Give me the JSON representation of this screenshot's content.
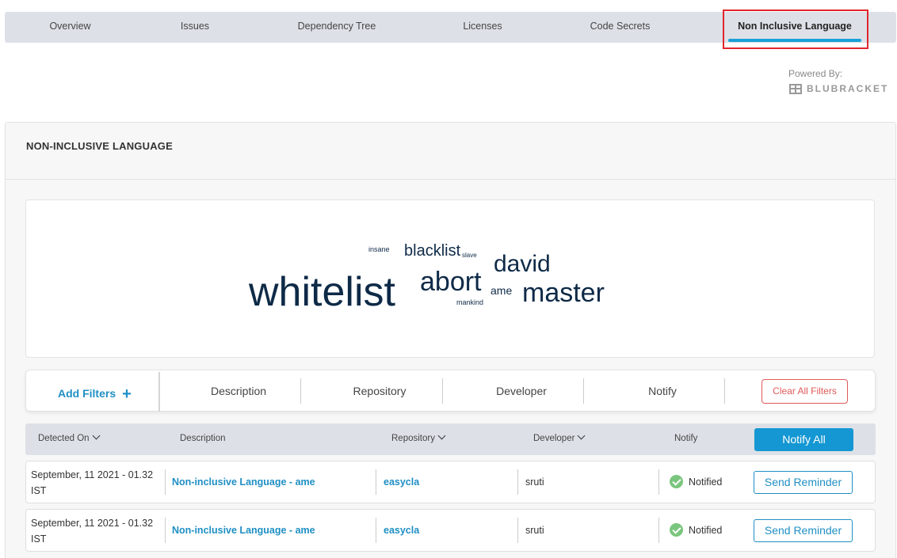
{
  "tabs": [
    {
      "label": "Overview"
    },
    {
      "label": "Issues"
    },
    {
      "label": "Dependency Tree"
    },
    {
      "label": "Licenses"
    },
    {
      "label": "Code Secrets"
    },
    {
      "label": "Non Inclusive Language",
      "active": true
    }
  ],
  "powered_by": {
    "label": "Powered By:",
    "brand": "BLUBRACKET"
  },
  "panel": {
    "title": "NON-INCLUSIVE LANGUAGE"
  },
  "word_cloud": {
    "words": [
      {
        "text": "insane"
      },
      {
        "text": "blacklist"
      },
      {
        "text": "slave"
      },
      {
        "text": "david"
      },
      {
        "text": "whitelist"
      },
      {
        "text": "abort"
      },
      {
        "text": "ame"
      },
      {
        "text": "master"
      },
      {
        "text": "mankind"
      }
    ]
  },
  "filters": {
    "add_label": "Add Filters",
    "items": [
      "Description",
      "Repository",
      "Developer",
      "Notify"
    ],
    "clear_label": "Clear All Filters"
  },
  "table": {
    "headers": {
      "detected_on": "Detected On",
      "description": "Description",
      "repository": "Repository",
      "developer": "Developer",
      "notify": "Notify"
    },
    "notify_all_label": "Notify All",
    "rows": [
      {
        "date": "September, 11 2021 - 01.32 IST",
        "description": "Non-inclusive Language - ame",
        "repository": "easycla",
        "developer": "sruti",
        "status": "Notified",
        "action": "Send Reminder"
      },
      {
        "date": "September, 11 2021 - 01.32 IST",
        "description": "Non-inclusive Language - ame",
        "repository": "easycla",
        "developer": "sruti",
        "status": "Notified",
        "action": "Send Reminder"
      }
    ]
  },
  "colors": {
    "accent": "#1497d3",
    "highlight": "#e0262e",
    "success": "#7bc67e",
    "danger": "#e05a5a"
  }
}
